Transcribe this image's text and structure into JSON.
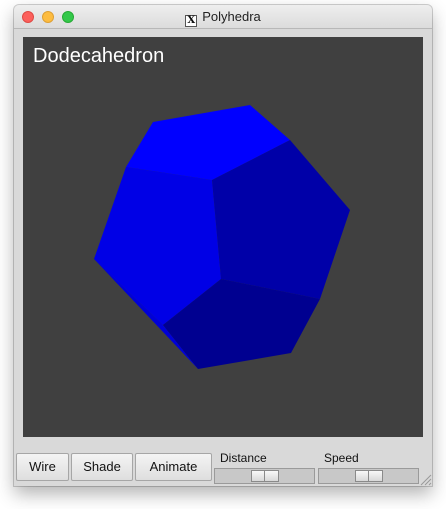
{
  "window": {
    "title": "Polyhedra",
    "title_icon": "x11-icon"
  },
  "canvas": {
    "label": "Dodecahedron",
    "background": "#404040",
    "face_colors": [
      "#0000ff",
      "#0000e0",
      "#0000cc",
      "#0000ab",
      "#00008f",
      "#0000a0",
      "#000098"
    ]
  },
  "controls": {
    "wire_label": "Wire",
    "shade_label": "Shade",
    "animate_label": "Animate",
    "distance_label": "Distance",
    "speed_label": "Speed",
    "distance_value": 0.5,
    "speed_value": 0.5
  }
}
